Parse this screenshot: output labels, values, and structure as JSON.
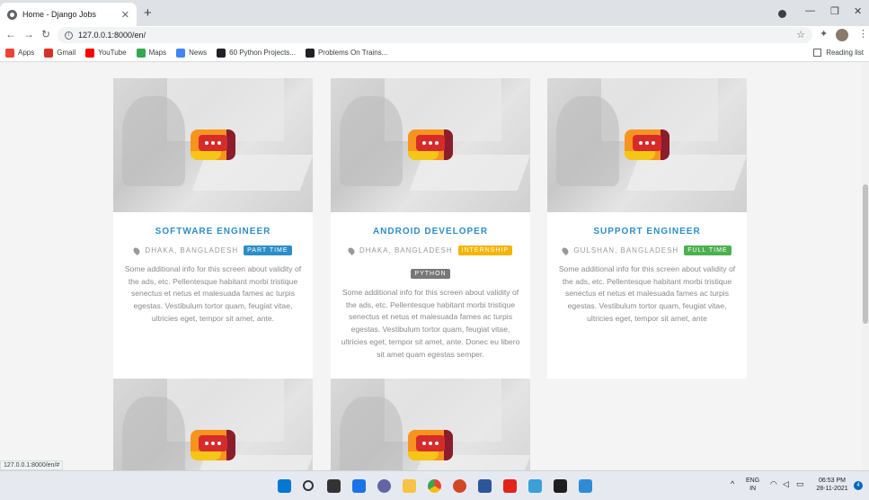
{
  "browser": {
    "tab_title": "Home - Django Jobs",
    "tab_close": "✕",
    "new_tab": "+",
    "url": "127.0.0.1:8000/en/",
    "status_url": "127.0.0.1:8000/en/#",
    "bookmarks": [
      {
        "label": "Apps",
        "color": "#ea4335"
      },
      {
        "label": "Gmail",
        "color": "#d93025"
      },
      {
        "label": "YouTube",
        "color": "#ff0000"
      },
      {
        "label": "Maps",
        "color": "#34a853"
      },
      {
        "label": "News",
        "color": "#4285f4"
      },
      {
        "label": "60 Python Projects...",
        "color": "#202124"
      },
      {
        "label": "Problems On Trains...",
        "color": "#202124"
      }
    ],
    "reading_list": "Reading list"
  },
  "jobs": [
    {
      "title": "SOFTWARE ENGINEER",
      "location": "DHAKA, BANGLADESH",
      "badges": [
        {
          "label": "PART TIME",
          "color": "#2c8ec7"
        }
      ],
      "description": "Some additional info for this screen about validity of the ads, etc. Pellentesque habitant morbi tristique senectus et netus et malesuada fames ac turpis egestas. Vestibulum tortor quam, feugiat vitae, ultricies eget, tempor sit amet, ante."
    },
    {
      "title": "ANDROID DEVELOPER",
      "location": "DHAKA, BANGLADESH",
      "badges": [
        {
          "label": "INTERNSHIP",
          "color": "#f5b400"
        },
        {
          "label": "PYTHON",
          "color": "#777777"
        }
      ],
      "description": "Some additional info for this screen about validity of the ads, etc. Pellentesque habitant morbi tristique senectus et netus et malesuada fames ac turpis egestas. Vestibulum tortor quam, feugiat vitae, ultricies eget, tempor sit amet, ante. Donec eu libero sit amet quam egestas semper."
    },
    {
      "title": "SUPPORT ENGINEER",
      "location": "GULSHAN, BANGLADESH",
      "badges": [
        {
          "label": "FULL TIME",
          "color": "#4caf50"
        }
      ],
      "description": "Some additional info for this screen about validity of the ads, etc. Pellentesque habitant morbi tristique senectus et netus et malesuada fames ac turpis egestas. Vestibulum tortor quam, feugiat vitae, ultricies eget, tempor sit amet, ante"
    }
  ],
  "taskbar": {
    "lang": "ENG",
    "region": "IN",
    "time": "06:53 PM",
    "date": "28-11-2021",
    "notifications": "4",
    "tray_chevron": "^"
  }
}
